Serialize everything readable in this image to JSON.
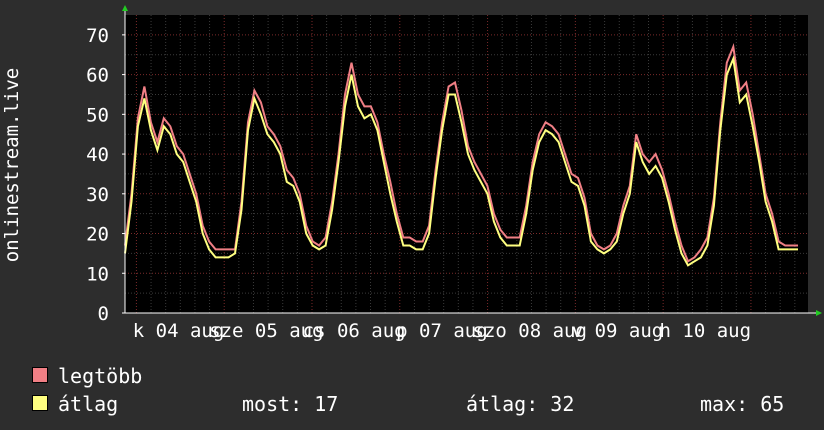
{
  "chart_data": {
    "type": "area",
    "ylabel": "onlinestream.live",
    "ylim": [
      0,
      75
    ],
    "yticks": [
      0,
      10,
      20,
      30,
      40,
      50,
      60,
      70
    ],
    "xtick_labels": [
      "k 04 aug",
      "sze 05 aug",
      "cs 06 aug",
      "p 07 aug",
      "szo 08 aug",
      "v 09 aug",
      "h 10 aug"
    ],
    "grid": true,
    "series": [
      {
        "name": "legtöbb",
        "color": "#f07f85",
        "values": [
          17,
          30,
          49,
          57,
          48,
          43,
          49,
          47,
          42,
          40,
          35,
          30,
          22,
          18,
          16,
          16,
          16,
          16,
          28,
          48,
          56,
          53,
          47,
          45,
          42,
          36,
          34,
          30,
          22,
          18,
          17,
          19,
          28,
          40,
          55,
          63,
          55,
          52,
          52,
          48,
          40,
          33,
          25,
          19,
          19,
          18,
          18,
          22,
          36,
          48,
          57,
          58,
          51,
          42,
          38,
          35,
          32,
          25,
          21,
          19,
          19,
          19,
          27,
          38,
          45,
          48,
          47,
          45,
          40,
          35,
          34,
          29,
          20,
          17,
          16,
          17,
          20,
          27,
          32,
          45,
          40,
          38,
          40,
          36,
          30,
          23,
          17,
          13,
          14,
          16,
          19,
          29,
          48,
          63,
          67,
          56,
          58,
          50,
          40,
          30,
          25,
          18,
          17,
          17,
          17
        ]
      },
      {
        "name": "átlag",
        "values": [
          15,
          28,
          47,
          54,
          46,
          41,
          47,
          45,
          40,
          38,
          33,
          28,
          20,
          16,
          14,
          14,
          14,
          15,
          26,
          46,
          54,
          50,
          45,
          43,
          40,
          33,
          32,
          28,
          20,
          17,
          16,
          17,
          26,
          38,
          52,
          60,
          52,
          49,
          50,
          46,
          38,
          30,
          23,
          17,
          17,
          16,
          16,
          20,
          34,
          46,
          55,
          55,
          48,
          40,
          36,
          33,
          30,
          23,
          19,
          17,
          17,
          17,
          25,
          36,
          43,
          46,
          45,
          43,
          38,
          33,
          32,
          27,
          18,
          16,
          15,
          16,
          18,
          25,
          30,
          43,
          38,
          35,
          37,
          34,
          28,
          21,
          15,
          12,
          13,
          14,
          17,
          27,
          46,
          60,
          64,
          53,
          55,
          47,
          38,
          28,
          23,
          16,
          16,
          16,
          16
        ],
        "color": "#ffff80"
      }
    ],
    "stats": {
      "most_label": "most:",
      "most_value": "17",
      "avg_label": "átlag:",
      "avg_value": "32",
      "max_label": "max:",
      "max_value": "65"
    }
  }
}
